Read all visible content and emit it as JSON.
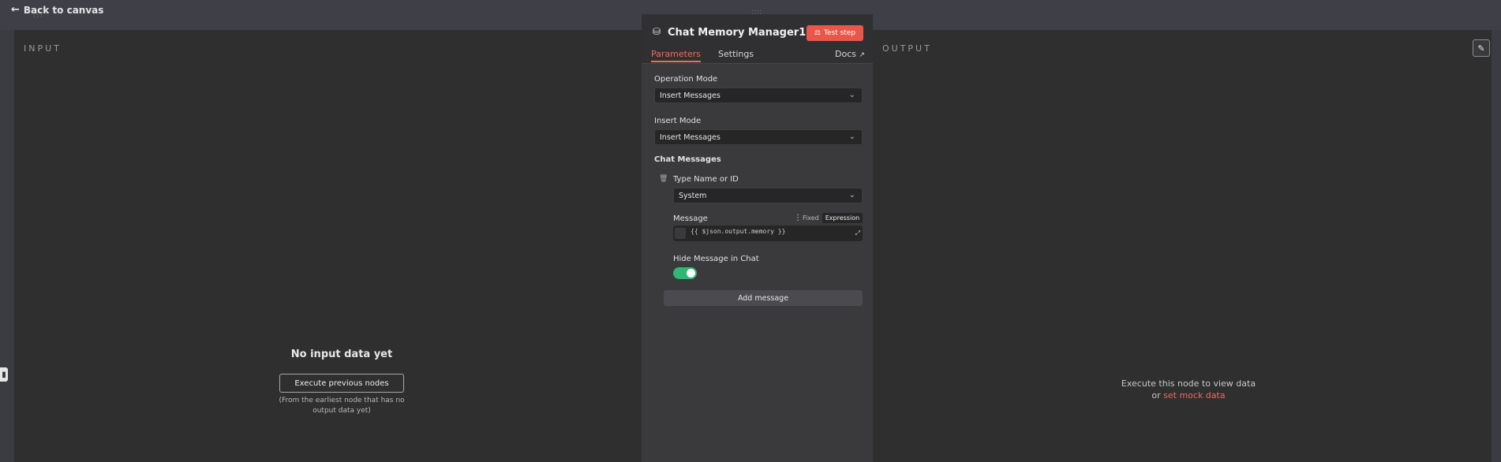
{
  "header": {
    "back_label": "Back to canvas",
    "back_icon": "arrow-left-icon"
  },
  "input_panel": {
    "title": "INPUT",
    "empty_title": "No input data yet",
    "execute_button": "Execute previous nodes",
    "hint": "(From the earliest node that has no output data yet)"
  },
  "output_panel": {
    "title": "OUTPUT",
    "hint_line1": "Execute this node to view data",
    "hint_or": "or ",
    "mock_link": "set mock data"
  },
  "node": {
    "title": "Chat Memory Manager1",
    "icon": "database-icon",
    "test_button": "Test step",
    "tabs": {
      "parameters": "Parameters",
      "settings": "Settings",
      "docs": "Docs"
    },
    "active_tab": "parameters",
    "accent_color": "#ea6e5b",
    "operation_mode": {
      "label": "Operation Mode",
      "value": "Insert Messages"
    },
    "insert_mode": {
      "label": "Insert Mode",
      "value": "Insert Messages"
    },
    "chat_messages": {
      "label": "Chat Messages",
      "type_name": {
        "label": "Type Name or ID",
        "value": "System"
      },
      "message": {
        "label": "Message",
        "fixed_label": "Fixed",
        "expression_label": "Expression",
        "expression_value": "{{ $json.output.memory }}"
      },
      "hide_message": {
        "label": "Hide Message in Chat",
        "enabled": true,
        "toggle_color": "#2eb872"
      },
      "add_button": "Add message"
    }
  }
}
